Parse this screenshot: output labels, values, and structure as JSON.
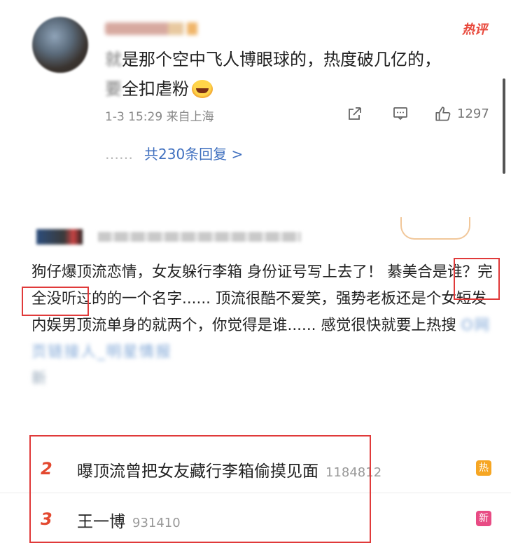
{
  "comment": {
    "tag": "热评",
    "text_blurred_start": "就",
    "text_line1": "是那个空中飞人博眼球的，热度破几亿的，",
    "text_blurred_mid": "要",
    "text_line2": "全扣虐粉",
    "emoji": "laughing-crying-emoji",
    "time_location": "1-3 15:29 来自上海",
    "like_count": "1297",
    "replies_dots": "……",
    "replies_label": "共230条回复 >"
  },
  "post": {
    "text": "狗仔爆顶流恋情，女友躲行李箱 身份证号写上去了！ 綦美合是谁？完全没听过的的一个名字...... 顶流很酷不爱笑，强势老板还是个女短发 内娱男顶流单身的就两个，你觉得是谁...... 感觉很快就要上热搜 ",
    "link_blurred": "O网页链接人_明星情报",
    "tail_blurred": "新"
  },
  "hot_search": [
    {
      "rank": "2",
      "title": "曝顶流曾把女友藏行李箱偷摸见面",
      "count": "1184812",
      "badge": "热"
    },
    {
      "rank": "3",
      "title": "王一博",
      "count": "931410",
      "badge": "新"
    }
  ],
  "colors": {
    "accent_red": "#e3482f",
    "link_blue": "#3f6fbf",
    "highlight_box": "#e03a3a",
    "badge_hot": "#f6a623",
    "badge_new": "#e84b84"
  }
}
